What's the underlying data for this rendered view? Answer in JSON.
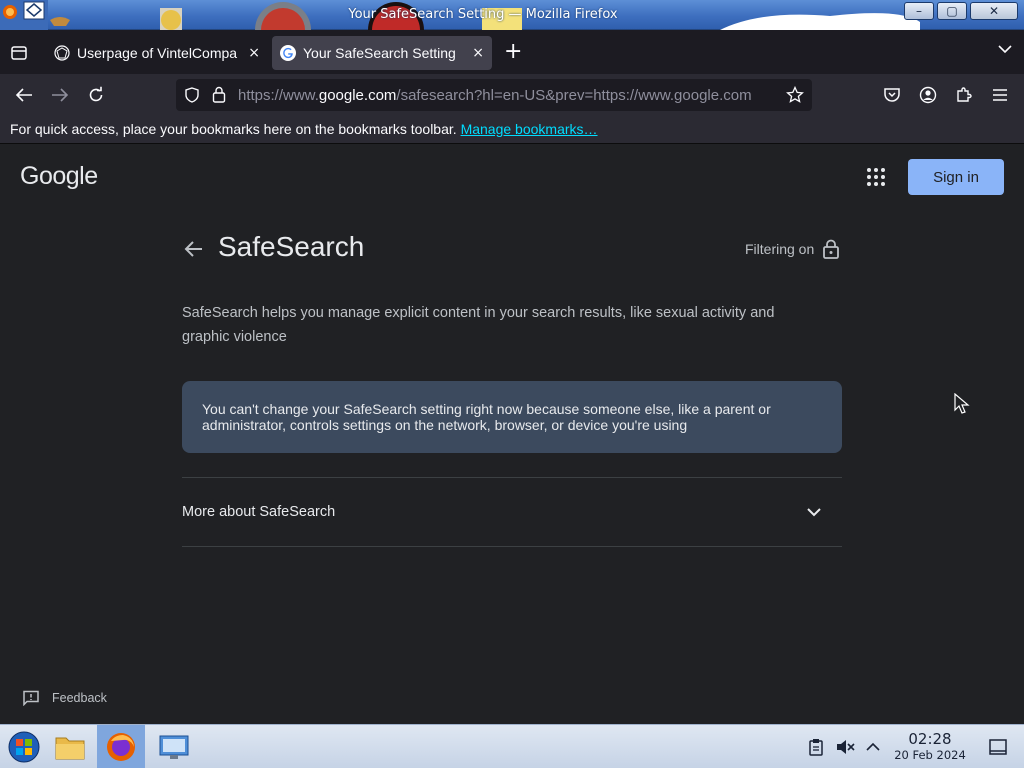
{
  "window": {
    "title": "Your SafeSearch Setting — Mozilla Firefox",
    "minimize_label": "–",
    "maximize_label": "▢",
    "close_label": "✕"
  },
  "tabs": [
    {
      "label": "Userpage of VintelCompa",
      "close": "×"
    },
    {
      "label": "Your SafeSearch Setting",
      "close": "×"
    }
  ],
  "newtab_label": "+",
  "navbar": {
    "url_prefix": "https://www.",
    "url_domain": "google.com",
    "url_rest": "/safesearch?hl=en-US&prev=https://www.google.com"
  },
  "bookmarks": {
    "text": "For quick access, place your bookmarks here on the bookmarks toolbar.",
    "link": "Manage bookmarks…"
  },
  "page": {
    "logo": "Google",
    "signin": "Sign in",
    "title": "SafeSearch",
    "filtering": "Filtering on",
    "description": "SafeSearch helps you manage explicit content in your search results, like sexual activity and graphic violence",
    "notice": "You can't change your SafeSearch setting right now because someone else, like a parent or administrator, controls settings on the network, browser, or device you're using",
    "more_about": "More about SafeSearch",
    "feedback": "Feedback"
  },
  "taskbar": {
    "time": "02:28",
    "date": "20 Feb 2024"
  },
  "colors": {
    "page_bg": "#202124",
    "notice_bg": "#3c4a5e",
    "signin_bg": "#8ab4f8",
    "link": "#00ddff"
  }
}
